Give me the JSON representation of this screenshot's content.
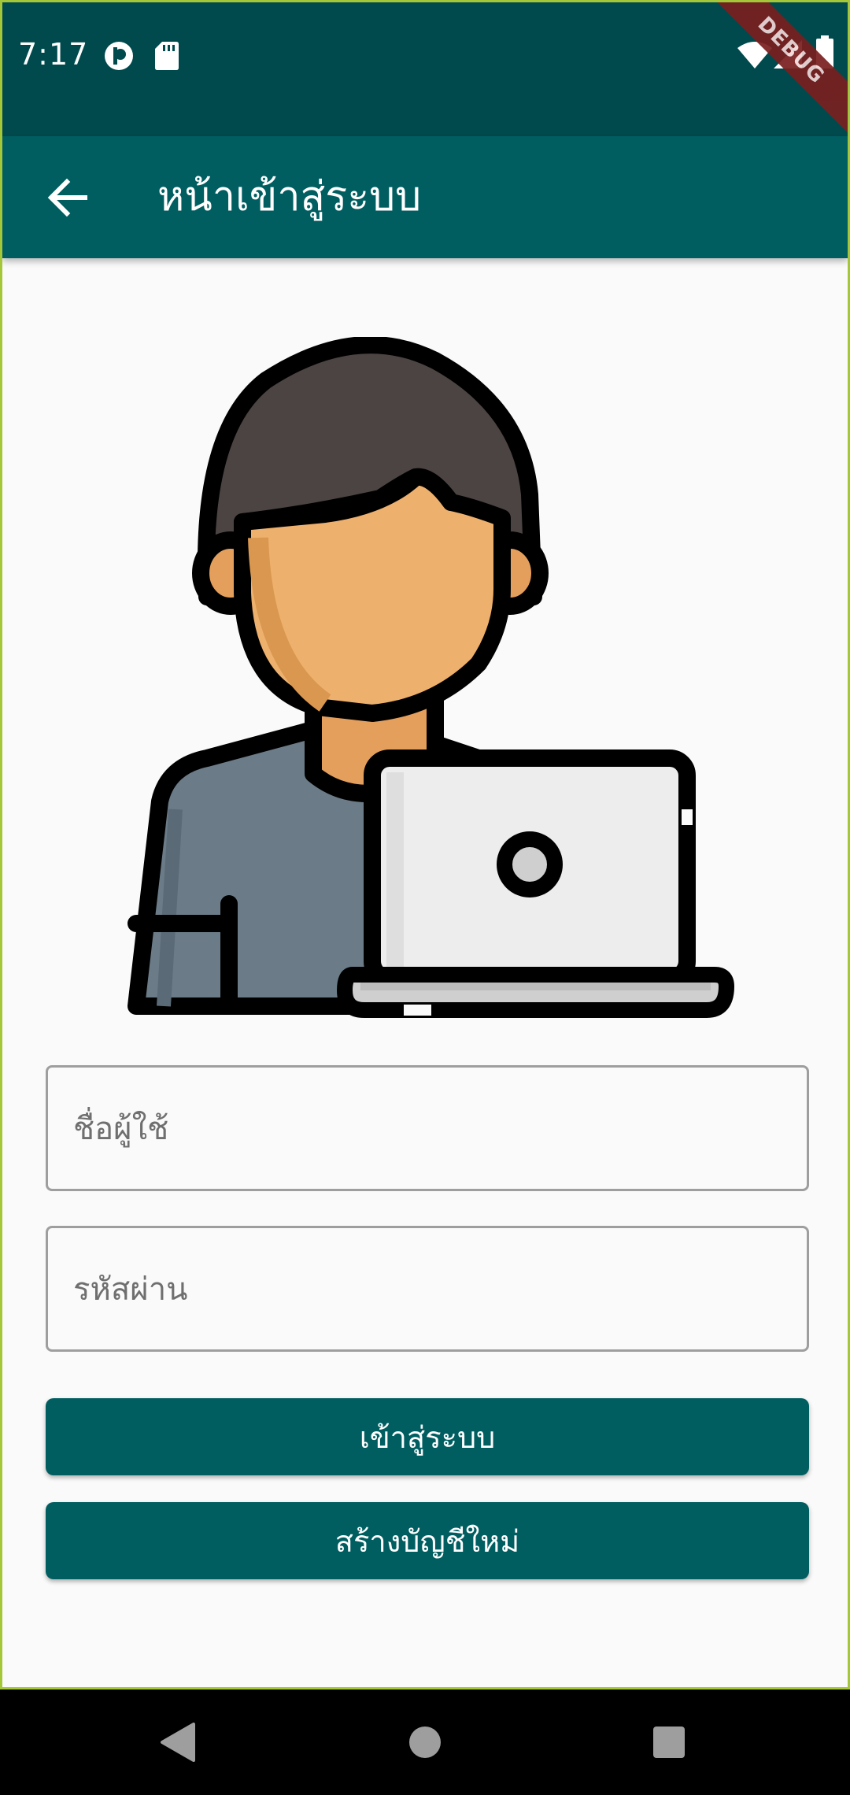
{
  "status_bar": {
    "time": "7:17",
    "icons": [
      "app-notification-icon",
      "sd-card-icon",
      "wifi-icon",
      "signal-icon",
      "battery-icon"
    ]
  },
  "debug_banner": {
    "label": "DEBUG"
  },
  "app_bar": {
    "title": "หน้าเข้าสู่ระบบ",
    "back_icon": "arrow-back-icon"
  },
  "illustration": {
    "icon": "user-with-laptop-illustration"
  },
  "form": {
    "username_placeholder": "ชื่อผู้ใช้",
    "username_value": "",
    "password_placeholder": "รหัสผ่าน",
    "password_value": ""
  },
  "buttons": {
    "login_label": "เข้าสู่ระบบ",
    "register_label": "สร้างบัญชีใหม่"
  },
  "nav_bar": {
    "icons": [
      "nav-back-icon",
      "nav-home-icon",
      "nav-recents-icon"
    ]
  },
  "colors": {
    "primary": "#005e61",
    "status_bar": "#004a4d",
    "skin": "#eeb06d",
    "hair": "#4b4442",
    "shirt": "#6b7c88"
  }
}
